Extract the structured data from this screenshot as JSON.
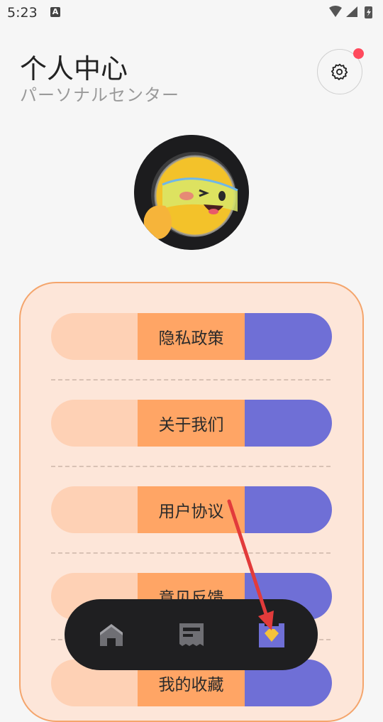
{
  "status_bar": {
    "time": "5:23",
    "notification_letter": "A"
  },
  "header": {
    "title": "个人中心",
    "subtitle": "パーソナルセンター"
  },
  "menu": {
    "items": [
      {
        "label": "隐私政策"
      },
      {
        "label": "关于我们"
      },
      {
        "label": "用户协议"
      },
      {
        "label": "意见反馈"
      },
      {
        "label": "我的收藏"
      }
    ]
  },
  "bottom_nav": {
    "items": [
      {
        "icon": "home-icon"
      },
      {
        "icon": "article-icon"
      },
      {
        "icon": "gem-icon",
        "active": true
      }
    ]
  },
  "colors": {
    "accent_orange": "#ffa565",
    "accent_purple": "#6f6fd6",
    "card_bg": "#fde6d9",
    "card_border": "#f4a56c",
    "notification_red": "#ff4a5d",
    "annotation_arrow": "#e23b3b"
  }
}
